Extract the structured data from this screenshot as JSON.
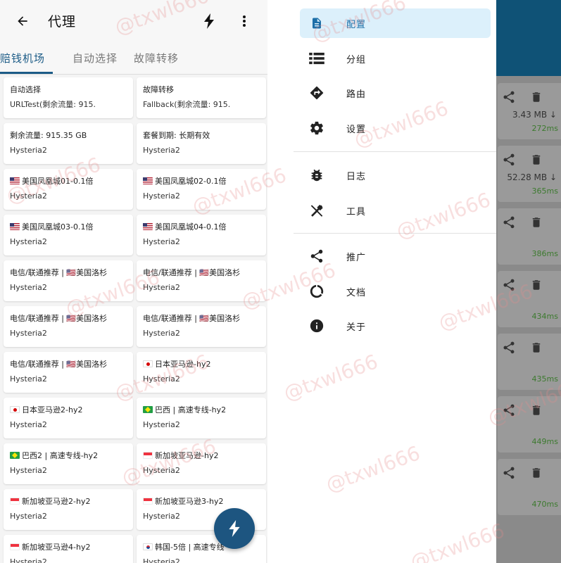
{
  "left_screen": {
    "title": "代理",
    "tabs": [
      "赔钱机场",
      "自动选择",
      "故障转移"
    ],
    "active_tab": 0,
    "cards": [
      {
        "flag": "",
        "line1": "自动选择",
        "line2": "URLTest(剩余流量: 915."
      },
      {
        "flag": "",
        "line1": "故障转移",
        "line2": "Fallback(剩余流量: 915."
      },
      {
        "flag": "",
        "line1": "剩余流量: 915.35 GB",
        "line2": "Hysteria2"
      },
      {
        "flag": "",
        "line1": "套餐到期: 长期有效",
        "line2": "Hysteria2"
      },
      {
        "flag": "us",
        "line1": "美国凤凰城01-0.1倍",
        "line2": "Hysteria2"
      },
      {
        "flag": "us",
        "line1": "美国凤凰城02-0.1倍",
        "line2": "Hysteria2"
      },
      {
        "flag": "us",
        "line1": "美国凤凰城03-0.1倍",
        "line2": "Hysteria2"
      },
      {
        "flag": "us",
        "line1": "美国凤凰城04-0.1倍",
        "line2": "Hysteria2"
      },
      {
        "flag": "",
        "line1": "电信/联通推荐 | 🇺🇸美国洛杉",
        "line2": "Hysteria2"
      },
      {
        "flag": "",
        "line1": "电信/联通推荐 | 🇺🇸美国洛杉",
        "line2": "Hysteria2"
      },
      {
        "flag": "",
        "line1": "电信/联通推荐 | 🇺🇸美国洛杉",
        "line2": "Hysteria2"
      },
      {
        "flag": "",
        "line1": "电信/联通推荐 | 🇺🇸美国洛杉",
        "line2": "Hysteria2"
      },
      {
        "flag": "",
        "line1": "电信/联通推荐 | 🇺🇸美国洛杉",
        "line2": "Hysteria2"
      },
      {
        "flag": "jp",
        "line1": "日本亚马逊-hy2",
        "line2": "Hysteria2"
      },
      {
        "flag": "jp",
        "line1": "日本亚马逊2-hy2",
        "line2": "Hysteria2"
      },
      {
        "flag": "br",
        "line1": "巴西 | 高速专线-hy2",
        "line2": "Hysteria2"
      },
      {
        "flag": "br",
        "line1": "巴西2 | 高速专线-hy2",
        "line2": "Hysteria2"
      },
      {
        "flag": "sg",
        "line1": "新加坡亚马逊-hy2",
        "line2": "Hysteria2"
      },
      {
        "flag": "sg",
        "line1": "新加坡亚马逊2-hy2",
        "line2": "Hysteria2"
      },
      {
        "flag": "sg",
        "line1": "新加坡亚马逊3-hy2",
        "line2": "Hysteria2"
      },
      {
        "flag": "sg",
        "line1": "新加坡亚马逊4-hy2",
        "line2": "Hysteria2"
      },
      {
        "flag": "kr",
        "line1": "韩国-5倍 | 高速专线",
        "line2": "Hysteria2"
      }
    ]
  },
  "drawer": {
    "groups": [
      [
        {
          "icon": "document-icon",
          "label": "配置",
          "active": true
        },
        {
          "icon": "list-icon",
          "label": "分组",
          "active": false
        },
        {
          "icon": "route-icon",
          "label": "路由",
          "active": false
        },
        {
          "icon": "gear-icon",
          "label": "设置",
          "active": false
        }
      ],
      [
        {
          "icon": "bug-icon",
          "label": "日志",
          "active": false
        },
        {
          "icon": "tools-icon",
          "label": "工具",
          "active": false
        }
      ],
      [
        {
          "icon": "share-icon",
          "label": "推广",
          "active": false
        },
        {
          "icon": "docs-icon",
          "label": "文档",
          "active": false
        },
        {
          "icon": "info-icon",
          "label": "关于",
          "active": false
        }
      ]
    ]
  },
  "background_profiles": [
    {
      "size": "3.43 MB ↓",
      "latency": "272ms"
    },
    {
      "size": "52.28 MB ↓",
      "latency": "365ms"
    },
    {
      "size": "",
      "latency": "386ms"
    },
    {
      "size": "",
      "latency": "434ms"
    },
    {
      "size": "",
      "latency": "435ms"
    },
    {
      "size": "",
      "latency": "449ms"
    },
    {
      "size": "",
      "latency": "470ms"
    }
  ],
  "watermark": "@txwl666",
  "colors": {
    "primary": "#1d5c87",
    "drawer_active_bg": "#dcf0fb",
    "latency_green": "#3c7a2e",
    "fab": "#1d5580"
  }
}
